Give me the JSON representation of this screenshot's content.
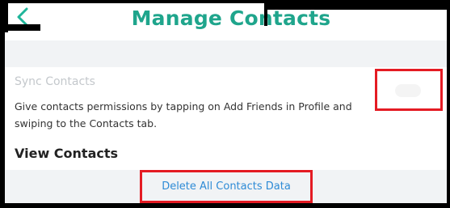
{
  "header": {
    "back_glyph": "<",
    "title": "Manage Contacts"
  },
  "sync": {
    "title": "Sync Contacts",
    "description": "Give contacts permissions by tapping on Add Friends in Profile and swiping to the Contacts tab.",
    "toggle_enabled": false
  },
  "view": {
    "label": "View Contacts"
  },
  "delete": {
    "label": "Delete All Contacts Data"
  },
  "colors": {
    "accent": "#1fa58c",
    "link": "#2e8bd6",
    "highlight_border": "#e41b23",
    "section_bg": "#f1f3f5"
  },
  "icons": {
    "back": "chevron-left-icon"
  }
}
